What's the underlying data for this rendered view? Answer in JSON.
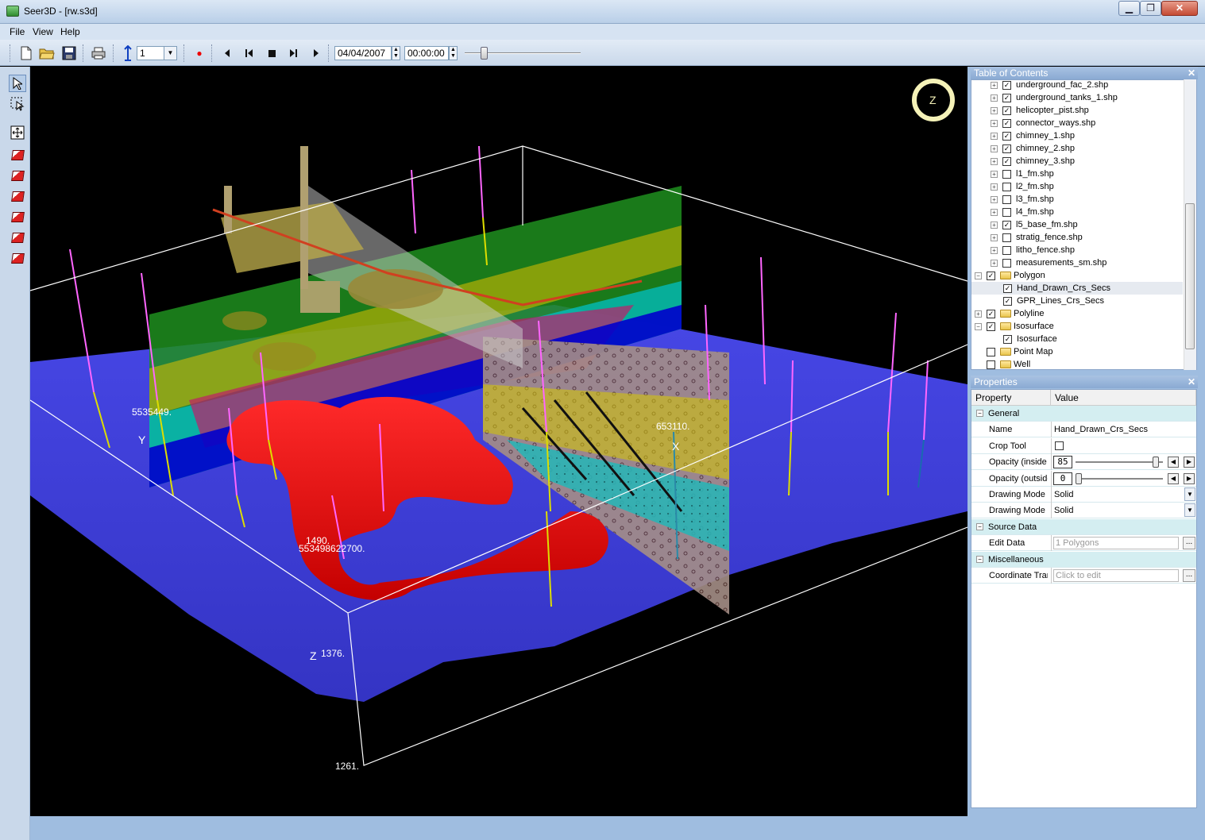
{
  "window": {
    "title": "Seer3D - [rw.s3d]",
    "controls": {
      "minimize": "▁",
      "maximize": "❐",
      "close": "✕"
    }
  },
  "menu": [
    "File",
    "View",
    "Help"
  ],
  "toolbar": {
    "layer_value": "1",
    "date": "04/04/2007",
    "time": "00:00:00",
    "icons": [
      "new-file-icon",
      "open-folder-icon",
      "save-icon",
      "print-icon",
      "vertical-exaggeration-icon",
      "record-icon",
      "go-start-icon",
      "step-back-icon",
      "stop-icon",
      "step-forward-icon",
      "go-end-icon"
    ]
  },
  "left_tools": [
    "select-arrow-icon",
    "box-select-icon",
    "zoom-extents-icon",
    "view-front-icon",
    "view-back-icon",
    "view-left-icon",
    "view-right-icon",
    "view-top-icon",
    "view-bottom-icon"
  ],
  "viewport": {
    "axis_labels": {
      "y_value": "5535449.",
      "y_letter": "Y",
      "x_value": "653110.",
      "x_letter": "X",
      "origin_a": "1490.",
      "origin_b": "553498622700.",
      "z_letter": "Z",
      "z_value": "1376.",
      "z_bottom": "1261."
    },
    "colors": {
      "ground": "#3a3adc",
      "isosurface": "#ff0000",
      "bbox": "#ffffff"
    }
  },
  "toc": {
    "title": "Table of Contents",
    "items": [
      {
        "label": "underground_fac_2.shp",
        "level": 2,
        "checked": true,
        "type": "layer"
      },
      {
        "label": "underground_tanks_1.shp",
        "level": 2,
        "checked": true,
        "type": "layer"
      },
      {
        "label": "helicopter_pist.shp",
        "level": 2,
        "checked": true,
        "type": "layer"
      },
      {
        "label": "connector_ways.shp",
        "level": 2,
        "checked": true,
        "type": "layer"
      },
      {
        "label": "chimney_1.shp",
        "level": 2,
        "checked": true,
        "type": "layer"
      },
      {
        "label": "chimney_2.shp",
        "level": 2,
        "checked": true,
        "type": "layer"
      },
      {
        "label": "chimney_3.shp",
        "level": 2,
        "checked": true,
        "type": "layer"
      },
      {
        "label": "l1_fm.shp",
        "level": 2,
        "checked": false,
        "type": "layer"
      },
      {
        "label": "l2_fm.shp",
        "level": 2,
        "checked": false,
        "type": "layer"
      },
      {
        "label": "l3_fm.shp",
        "level": 2,
        "checked": false,
        "type": "layer"
      },
      {
        "label": "l4_fm.shp",
        "level": 2,
        "checked": false,
        "type": "layer"
      },
      {
        "label": "l5_base_fm.shp",
        "level": 2,
        "checked": true,
        "type": "layer"
      },
      {
        "label": "stratig_fence.shp",
        "level": 2,
        "checked": false,
        "type": "layer"
      },
      {
        "label": "litho_fence.shp",
        "level": 2,
        "checked": false,
        "type": "layer"
      },
      {
        "label": "measurements_sm.shp",
        "level": 2,
        "checked": false,
        "type": "layer"
      },
      {
        "label": "Polygon",
        "level": 1,
        "checked": true,
        "type": "folder",
        "expanded": true
      },
      {
        "label": "Hand_Drawn_Crs_Secs",
        "level": 3,
        "checked": true,
        "type": "leaf",
        "selected": true
      },
      {
        "label": "GPR_Lines_Crs_Secs",
        "level": 3,
        "checked": true,
        "type": "leaf"
      },
      {
        "label": "Polyline",
        "level": 1,
        "checked": true,
        "type": "folder",
        "expanded": false
      },
      {
        "label": "Isosurface",
        "level": 1,
        "checked": true,
        "type": "folder",
        "expanded": true
      },
      {
        "label": "Isosurface",
        "level": 3,
        "checked": true,
        "type": "leaf"
      },
      {
        "label": "Point Map",
        "level": 1,
        "checked": false,
        "type": "folder-noexp"
      },
      {
        "label": "Well",
        "level": 1,
        "checked": false,
        "type": "folder-noexp"
      }
    ]
  },
  "properties": {
    "title": "Properties",
    "col_property": "Property",
    "col_value": "Value",
    "rows": [
      {
        "kind": "cat",
        "key": "General"
      },
      {
        "kind": "text",
        "key": "Name",
        "value": "Hand_Drawn_Crs_Secs"
      },
      {
        "kind": "check",
        "key": "Crop Tool",
        "value": ""
      },
      {
        "kind": "slider",
        "key": "Opacity (inside c",
        "value": "85",
        "level": 0.93
      },
      {
        "kind": "slider",
        "key": "Opacity (outside",
        "value": "0",
        "level": 0.0
      },
      {
        "kind": "dropdown",
        "key": "Drawing Mode (",
        "value": "Solid"
      },
      {
        "kind": "dropdown",
        "key": "Drawing Mode (",
        "value": "Solid"
      },
      {
        "kind": "cat",
        "key": "Source Data"
      },
      {
        "kind": "ghost",
        "key": "Edit Data",
        "value": "1 Polygons"
      },
      {
        "kind": "cat",
        "key": "Miscellaneous"
      },
      {
        "kind": "ghost",
        "key": "Coordinate Tran",
        "value": "Click to edit"
      }
    ]
  }
}
